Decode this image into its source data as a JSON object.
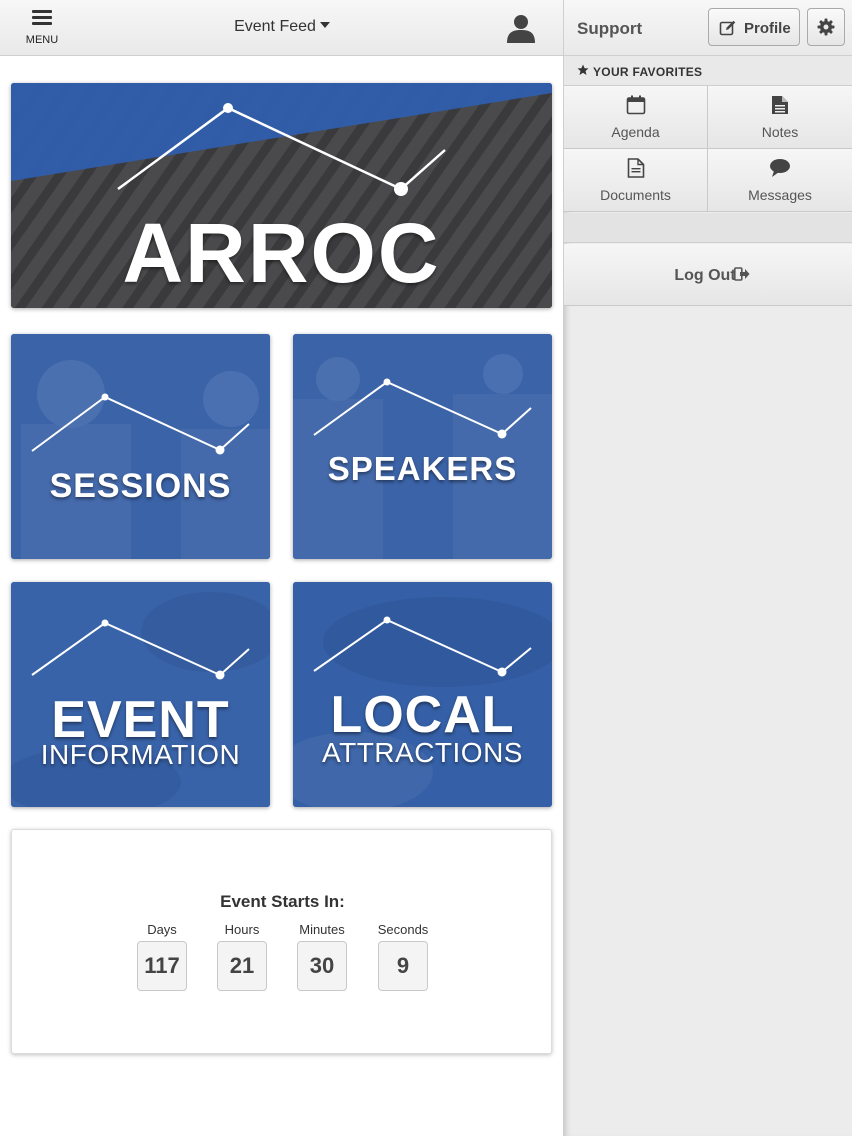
{
  "topbar": {
    "menu_label": "MENU",
    "title": "Event Feed"
  },
  "tiles": {
    "hero": "ARROC",
    "sessions": "SESSIONS",
    "speakers": "SPEAKERS",
    "event_main": "EVENT",
    "event_sub": "INFORMATION",
    "local_main": "LOCAL",
    "local_sub": "ATTRACTIONS"
  },
  "countdown": {
    "title": "Event Starts In:",
    "units": [
      {
        "label": "Days",
        "value": "117"
      },
      {
        "label": "Hours",
        "value": "21"
      },
      {
        "label": "Minutes",
        "value": "30"
      },
      {
        "label": "Seconds",
        "value": "9"
      }
    ]
  },
  "side": {
    "support": "Support",
    "profile": "Profile",
    "favorites_header": "YOUR FAVORITES",
    "favorites": [
      {
        "label": "Agenda",
        "icon": "calendar-icon"
      },
      {
        "label": "Notes",
        "icon": "document-icon"
      },
      {
        "label": "Documents",
        "icon": "file-icon"
      },
      {
        "label": "Messages",
        "icon": "speech-bubble-icon"
      }
    ],
    "logout": "Log Out"
  },
  "colors": {
    "tile_blue": "#3b63a8",
    "hero_dark": "#454547",
    "hero_stripe": "#2f5fb3"
  }
}
